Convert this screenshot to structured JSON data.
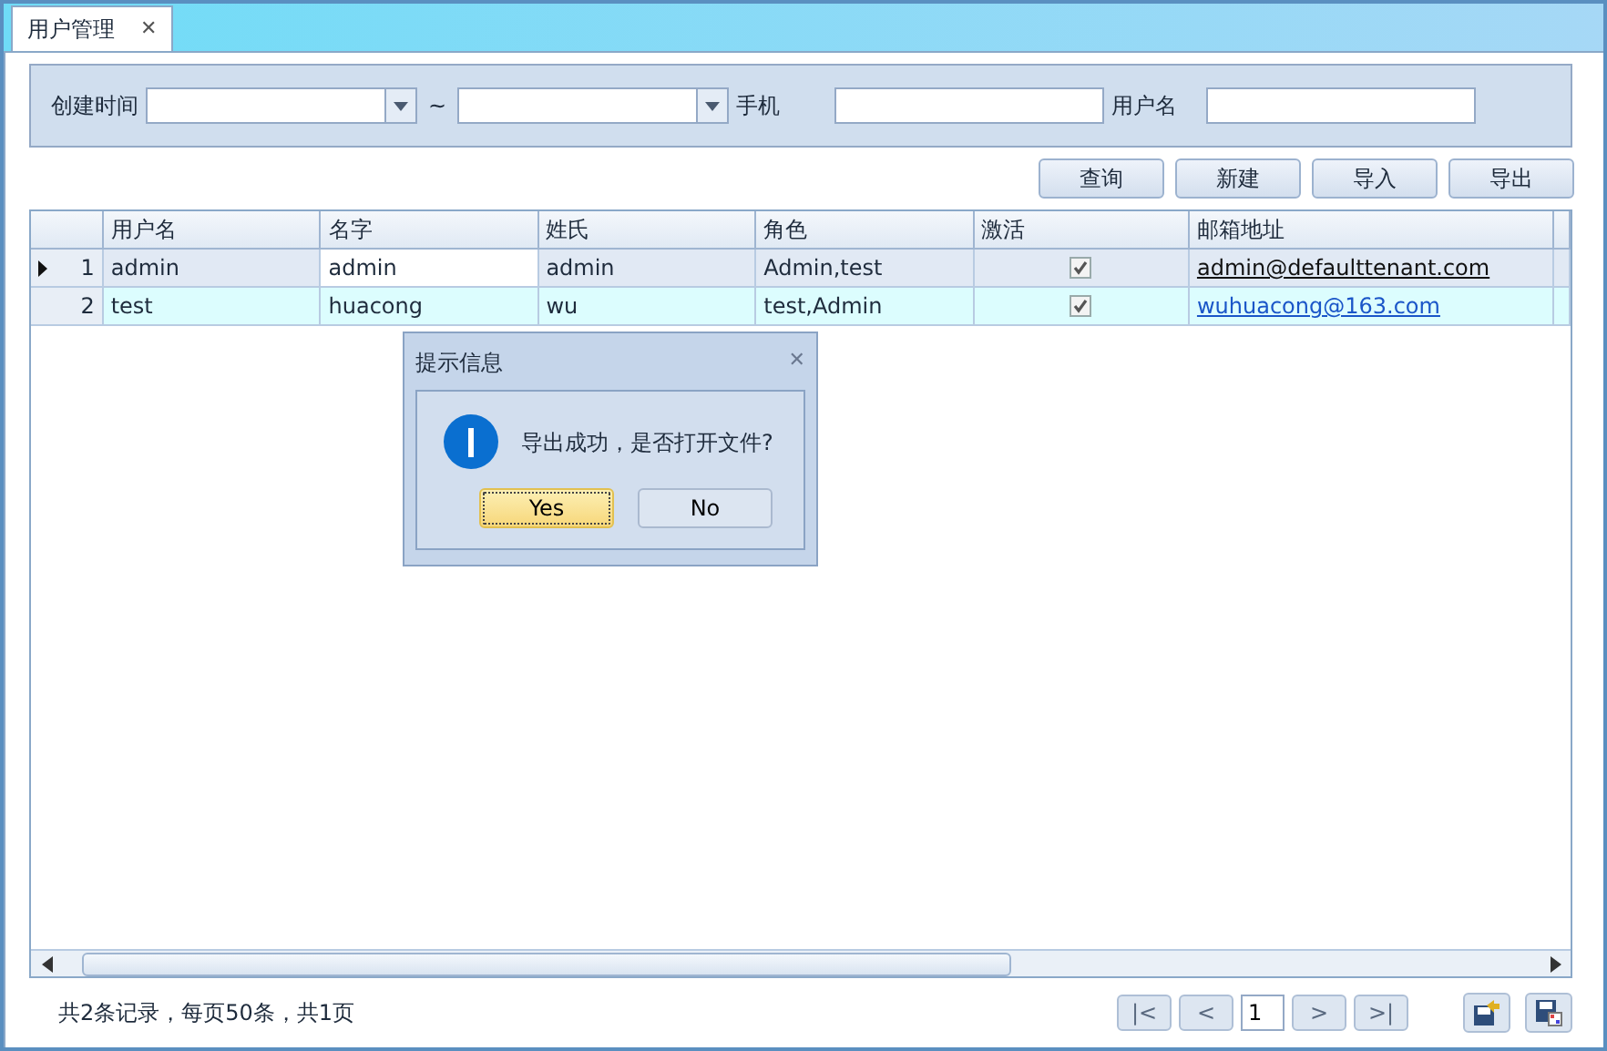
{
  "tabs": [
    {
      "label": "用户管理",
      "close": "✕",
      "selected": true
    }
  ],
  "filters": [
    {
      "kind": "date",
      "label": "创建时间"
    },
    {
      "kind": "date",
      "label": "~"
    },
    {
      "kind": "text",
      "label": "手机"
    },
    {
      "kind": "text",
      "label": "用户名"
    }
  ],
  "buttons": [
    "查询",
    "新建",
    "导入",
    "导出"
  ],
  "table": {
    "columns": [
      "用户名",
      "名字",
      "姓氏",
      "角色",
      "激活",
      "邮箱地址"
    ],
    "rows": [
      {
        "number": "1",
        "selected": true,
        "cells": [
          "admin",
          "admin",
          "admin",
          "Admin,test"
        ],
        "active": true,
        "email": "admin@defaulttenant.com"
      },
      {
        "number": "2",
        "selected": false,
        "cells": [
          "test",
          "huacong",
          "wu",
          "test,Admin"
        ],
        "active": true,
        "email": "wuhuacong@163.com"
      }
    ]
  },
  "status_bar": {
    "summary": "共2条记录，每页50条，共1页",
    "pager": [
      "|<",
      "<",
      ">",
      ">|"
    ],
    "page": "1"
  },
  "dialog": {
    "title": "提示信息",
    "close": "✕",
    "message": "导出成功，是否打开文件?",
    "buttons": [
      {
        "label": "Yes",
        "default": true
      },
      {
        "label": "No",
        "default": false
      }
    ]
  }
}
